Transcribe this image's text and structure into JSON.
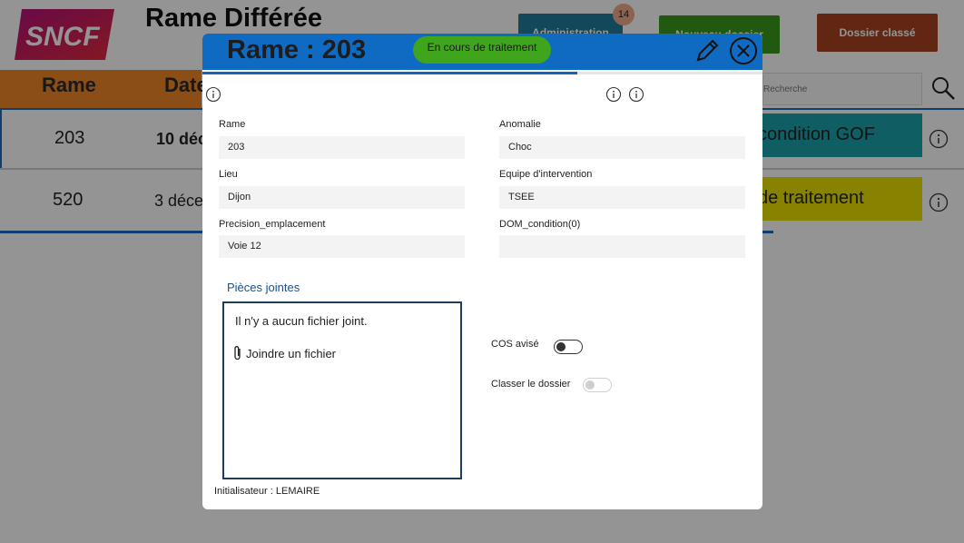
{
  "app": {
    "title": "Rame Différée",
    "logo_text": "SNCF",
    "buttons": {
      "administration": "Administration",
      "administration_badge": "14",
      "nouveau": "Nouveau dossier",
      "dossier_classe": "Dossier classé"
    },
    "columns": {
      "rame": "Rame",
      "date": "Date"
    },
    "search": {
      "placeholder": "Recherche"
    },
    "rows": [
      {
        "rame": "203",
        "date": "10 déc",
        "status": "condition GOF"
      },
      {
        "rame": "520",
        "date": "3 déce",
        "status": "de traitement"
      }
    ],
    "colors": {
      "orange": "#ee8727",
      "teal": "#1aa3ad",
      "yellow": "#e8e000",
      "blue": "#1a6dbf"
    }
  },
  "modal": {
    "title": "Rame : 203",
    "status": "En cours de traitement",
    "progress": 0.67,
    "fields": {
      "rame": {
        "label": "Rame",
        "value": "203"
      },
      "lieu": {
        "label": "Lieu",
        "value": "Dijon"
      },
      "precision": {
        "label": "Precision_emplacement",
        "value": "Voie 12"
      },
      "anomalie": {
        "label": "Anomalie",
        "value": "Choc"
      },
      "equipe": {
        "label": "Equipe d'intervention",
        "value": "TSEE"
      },
      "dom": {
        "label": "DOM_condition(0)",
        "value": ""
      }
    },
    "pieces": {
      "title": "Pièces jointes",
      "empty": "Il n'y a aucun fichier joint.",
      "attach": "Joindre un fichier"
    },
    "toggles": {
      "cos": {
        "label": "COS avisé",
        "on": false
      },
      "classer": {
        "label": "Classer le dossier",
        "on": false
      }
    },
    "initiator": "Initialisateur : LEMAIRE",
    "colors": {
      "header": "#0f6bc2",
      "status_pill": "#3fa51c"
    }
  }
}
